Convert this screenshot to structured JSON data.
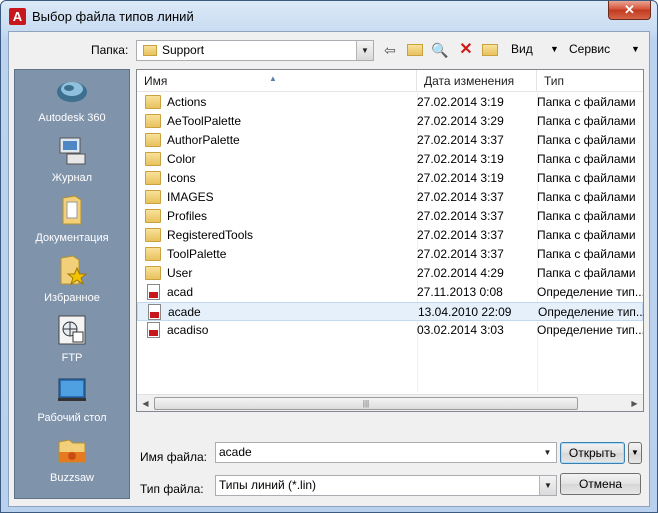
{
  "window": {
    "title": "Выбор файла типов линий",
    "close_glyph": "✕",
    "accent": "#c8161d"
  },
  "toolbar": {
    "folder_label": "Папка:",
    "folder_value": "Support",
    "views_label": "Вид",
    "tools_label": "Сервис"
  },
  "places": [
    {
      "label": "Autodesk 360",
      "icon": "cloud-icon"
    },
    {
      "label": "Журнал",
      "icon": "history-icon"
    },
    {
      "label": "Документация",
      "icon": "documents-icon"
    },
    {
      "label": "Избранное",
      "icon": "favorites-icon"
    },
    {
      "label": "FTP",
      "icon": "ftp-icon"
    },
    {
      "label": "Рабочий стол",
      "icon": "desktop-icon"
    },
    {
      "label": "Buzzsaw",
      "icon": "buzzsaw-icon"
    }
  ],
  "columns": {
    "name": "Имя",
    "date": "Дата изменения",
    "type": "Тип"
  },
  "files": [
    {
      "name": "Actions",
      "date": "27.02.2014 3:19",
      "type": "Папка с файлами",
      "kind": "folder"
    },
    {
      "name": "AeToolPalette",
      "date": "27.02.2014 3:29",
      "type": "Папка с файлами",
      "kind": "folder"
    },
    {
      "name": "AuthorPalette",
      "date": "27.02.2014 3:37",
      "type": "Папка с файлами",
      "kind": "folder"
    },
    {
      "name": "Color",
      "date": "27.02.2014 3:19",
      "type": "Папка с файлами",
      "kind": "folder"
    },
    {
      "name": "Icons",
      "date": "27.02.2014 3:19",
      "type": "Папка с файлами",
      "kind": "folder"
    },
    {
      "name": "IMAGES",
      "date": "27.02.2014 3:37",
      "type": "Папка с файлами",
      "kind": "folder"
    },
    {
      "name": "Profiles",
      "date": "27.02.2014 3:37",
      "type": "Папка с файлами",
      "kind": "folder"
    },
    {
      "name": "RegisteredTools",
      "date": "27.02.2014 3:37",
      "type": "Папка с файлами",
      "kind": "folder"
    },
    {
      "name": "ToolPalette",
      "date": "27.02.2014 3:37",
      "type": "Папка с файлами",
      "kind": "folder"
    },
    {
      "name": "User",
      "date": "27.02.2014 4:29",
      "type": "Папка с файлами",
      "kind": "folder"
    },
    {
      "name": "acad",
      "date": "27.11.2013 0:08",
      "type": "Определение тип...",
      "kind": "lin"
    },
    {
      "name": "acade",
      "date": "13.04.2010 22:09",
      "type": "Определение тип...",
      "kind": "lin",
      "selected": true
    },
    {
      "name": "acadiso",
      "date": "03.02.2014 3:03",
      "type": "Определение тип...",
      "kind": "lin"
    }
  ],
  "bottom": {
    "filename_label": "Имя файла:",
    "filename_value": "acade",
    "filetype_label": "Тип файла:",
    "filetype_value": "Типы линий (*.lin)",
    "open_button": "Открыть",
    "cancel_button": "Отмена"
  }
}
